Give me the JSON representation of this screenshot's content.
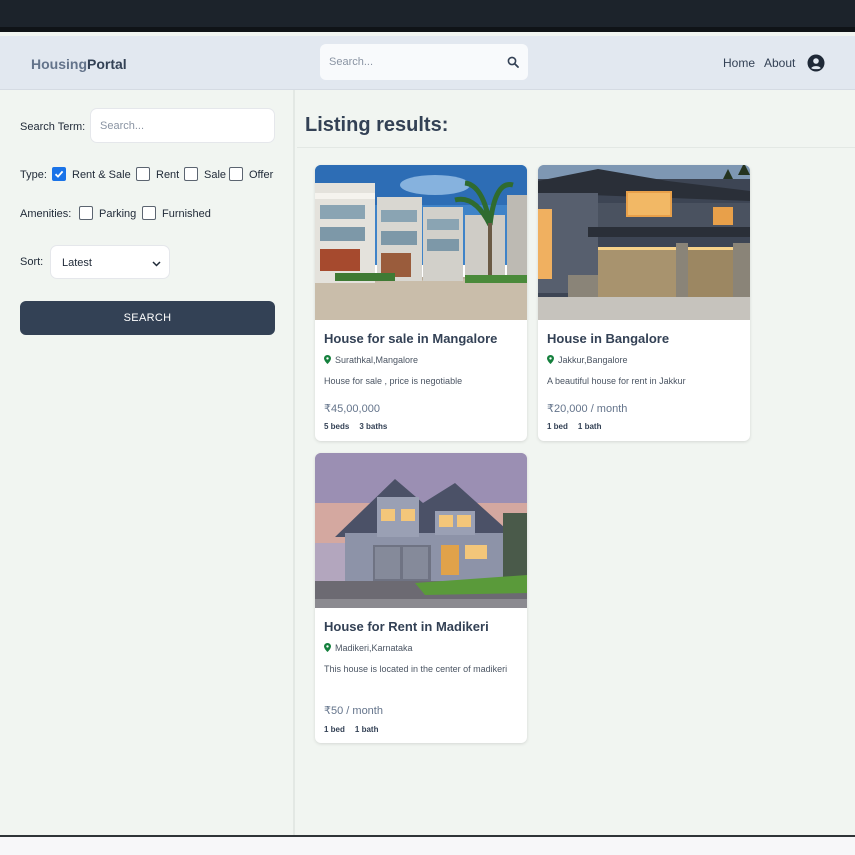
{
  "header": {
    "logo_part1": "Housing",
    "logo_part2": "Portal",
    "search_placeholder": "Search...",
    "nav": [
      "Home",
      "About"
    ]
  },
  "sidebar": {
    "search_term_label": "Search Term:",
    "search_placeholder": "Search...",
    "type_label": "Type:",
    "type_options": [
      {
        "label": "Rent & Sale",
        "checked": true
      },
      {
        "label": "Rent",
        "checked": false
      },
      {
        "label": "Sale",
        "checked": false
      },
      {
        "label": "Offer",
        "checked": false
      }
    ],
    "amenities_label": "Amenities:",
    "amenities": [
      {
        "label": "Parking",
        "checked": false
      },
      {
        "label": "Furnished",
        "checked": false
      }
    ],
    "sort_label": "Sort:",
    "sort_value": "Latest",
    "search_button": "SEARCH"
  },
  "main": {
    "title": "Listing results:",
    "listings": [
      {
        "title": "House for sale in Mangalore",
        "location": "Surathkal,Mangalore",
        "description": "House for sale , price is negotiable",
        "price": "₹45,00,000",
        "beds": "5 beds",
        "baths": "3 baths"
      },
      {
        "title": "House in Bangalore",
        "location": "Jakkur,Bangalore",
        "description": "A beautiful house for rent in Jakkur",
        "price": "₹20,000 / month",
        "beds": "1 bed",
        "baths": "1 bath"
      },
      {
        "title": "House for Rent in Madikeri",
        "location": "Madikeri,Karnataka",
        "description": "This house is located in the center of madikeri",
        "price": "₹50 / month",
        "beds": "1 bed",
        "baths": "1 bath"
      }
    ]
  },
  "colors": {
    "accent": "#334155",
    "checkbox": "#1a73e8",
    "location_pin": "#15803d"
  }
}
